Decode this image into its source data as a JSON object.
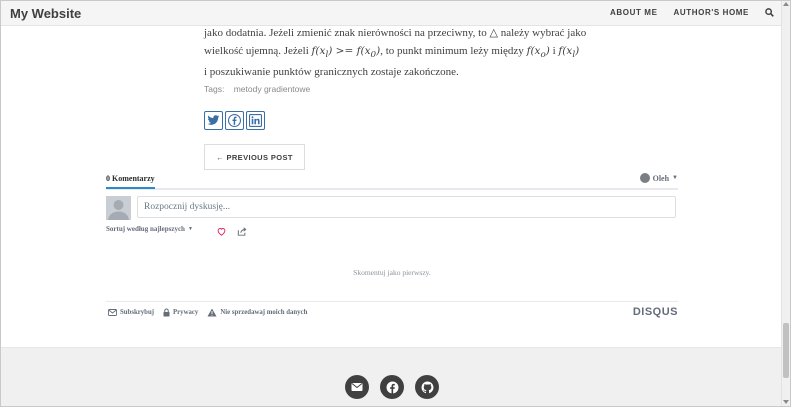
{
  "navbar": {
    "brand": "My Website",
    "links": [
      "ABOUT ME",
      "AUTHOR'S HOME"
    ],
    "search_icon": "search-icon"
  },
  "article": {
    "line1": "jako dodatnia. Jeżeli zmienić znak nierówności na przeciwny, to △ należy wybrać jako",
    "line2_a": "wielkość ujemną. Jeżeli ",
    "line2_m1": "f(x",
    "line2_m1_sub": "l",
    "line2_m1_end": ") >= f(x",
    "line2_m1_sub2": "0",
    "line2_m1_end2": ")",
    "line2_b": ", to punkt minimum leży między ",
    "line2_m2": "f(x",
    "line2_m2_sub": "o",
    "line2_m2_end": ")",
    "line2_c": " i ",
    "line2_m3": "f(x",
    "line2_m3_sub": "l",
    "line2_m3_end": ")",
    "line3": "i poszukiwanie punktów granicznych zostaje zakończone."
  },
  "tags": {
    "label": "Tags:",
    "items": [
      "metody gradientowe"
    ]
  },
  "share": {
    "icons": [
      "twitter-icon",
      "facebook-icon",
      "linkedin-icon"
    ],
    "color": "#3a6ea5"
  },
  "pager": {
    "previous_label": "← PREVIOUS POST"
  },
  "disqus": {
    "comment_count_label": "0 Komentarzy",
    "user_name": "Oleh",
    "input_placeholder": "Rozpocznij dyskusję...",
    "sort_label": "Sortuj według najlepszych",
    "empty_text": "Skomentuj jako pierwszy.",
    "footer_items": [
      "Subskrybuj",
      "Prywacy",
      "Nie sprzedawaj moich danych"
    ],
    "logo": "DISQUS",
    "accent": "#2a8bc5"
  },
  "footer": {
    "social_icons": [
      "email-icon",
      "facebook-icon",
      "github-icon"
    ]
  }
}
